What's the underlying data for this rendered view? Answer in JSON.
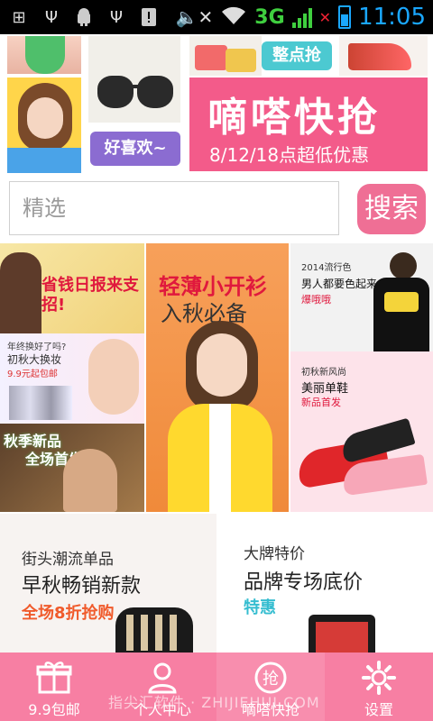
{
  "status_bar": {
    "network": "3G",
    "time": "11:05",
    "icons": [
      "add-icon",
      "usb-icon",
      "android-icon",
      "usb-icon",
      "warning-icon",
      "mute-icon",
      "wifi-icon",
      "signal-icon",
      "no-sim-icon",
      "battery-icon"
    ]
  },
  "banner": {
    "like_label": "好喜欢~",
    "hour_rush_badge": "整点抢",
    "flash_title": "嘀嗒快抢",
    "flash_subtitle": "8/12/18点超低优惠"
  },
  "search": {
    "placeholder": "精选",
    "button_label": "搜索"
  },
  "promos": {
    "saving_daily": {
      "tag": "省钱日报",
      "title": "省钱日报来支招!"
    },
    "skincare": {
      "line1": "年终换好了吗?",
      "line2": "初秋大换妆",
      "line3": "9.9元起包邮"
    },
    "autumn_new": {
      "line1": "秋季新品",
      "line2": "全场首发"
    },
    "cardigan": {
      "title": "轻薄小开衫",
      "subtitle": "入秋必备"
    },
    "men_tee": {
      "line1": "2014流行色",
      "line2": "男人都要色起来",
      "line3": "爆哦哦"
    },
    "shoes": {
      "line1": "初秋新风尚",
      "line2": "美丽单鞋",
      "line3": "新品首发"
    }
  },
  "feature_cards": [
    {
      "kicker": "街头潮流单品",
      "title": "早秋畅销新款",
      "subtitle": "全场8折抢购"
    },
    {
      "kicker": "大牌特价",
      "title": "品牌专场底价",
      "subtitle": "特惠"
    }
  ],
  "bottom_nav": [
    {
      "label": "9.9包邮",
      "icon": "gift-box-icon"
    },
    {
      "label": "个人中心",
      "icon": "user-icon"
    },
    {
      "label": "嘀嗒快抢",
      "icon": "flash-sale-icon"
    },
    {
      "label": "设置",
      "icon": "gear-icon"
    }
  ],
  "watermark": "指尖汇软件 · ZHIJIEHUI.COM",
  "colors": {
    "accent_pink": "#f77fa3",
    "flash_pink": "#f35b8a",
    "purple": "#8b6cd1",
    "teal": "#4cc9d1",
    "orange_red": "#f05a2b"
  }
}
